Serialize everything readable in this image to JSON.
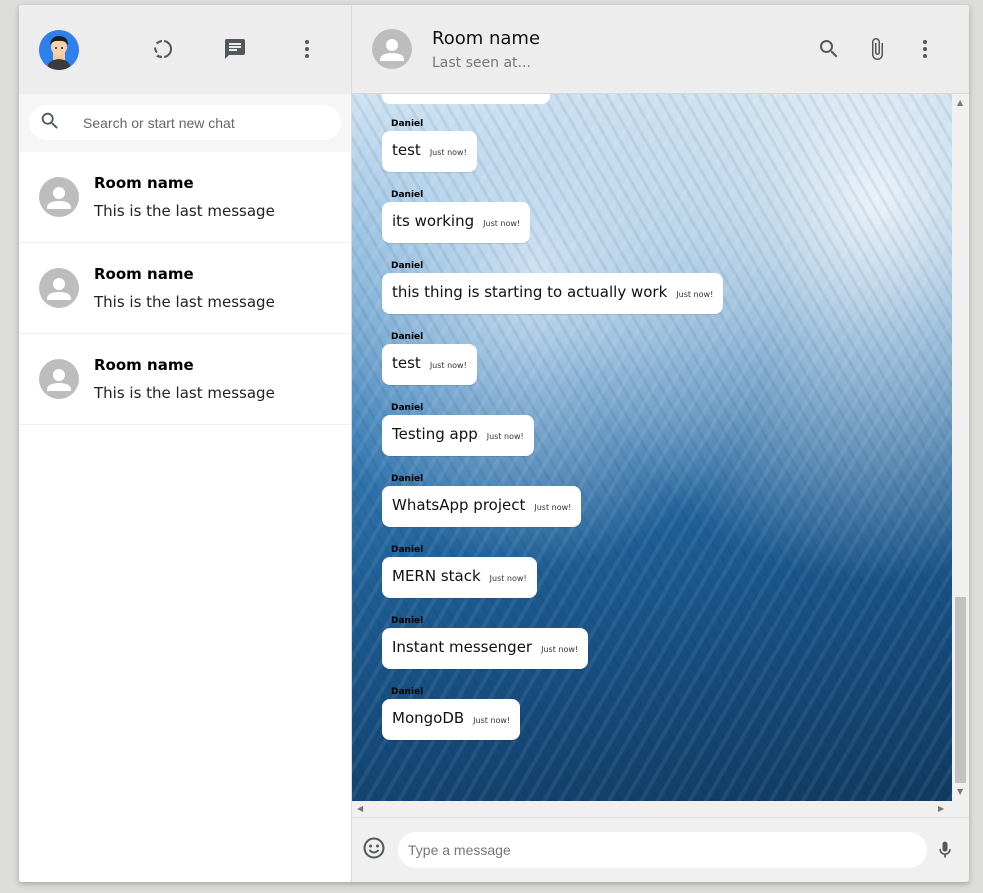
{
  "sidebar": {
    "search_placeholder": "Search or start new chat",
    "chats": [
      {
        "name": "Room name",
        "last": "This is the last message"
      },
      {
        "name": "Room name",
        "last": "This is the last message"
      },
      {
        "name": "Room name",
        "last": "This is the last message"
      }
    ]
  },
  "chat": {
    "title": "Room name",
    "subtitle": "Last seen at...",
    "messages": [
      {
        "sender": "Daniel",
        "text": "test",
        "time": "Just now!"
      },
      {
        "sender": "Daniel",
        "text": "its working",
        "time": "Just now!"
      },
      {
        "sender": "Daniel",
        "text": "this thing is starting to actually work",
        "time": "Just now!"
      },
      {
        "sender": "Daniel",
        "text": "test",
        "time": "Just now!"
      },
      {
        "sender": "Daniel",
        "text": "Testing app",
        "time": "Just now!"
      },
      {
        "sender": "Daniel",
        "text": "WhatsApp project",
        "time": "Just now!"
      },
      {
        "sender": "Daniel",
        "text": "MERN stack",
        "time": "Just now!"
      },
      {
        "sender": "Daniel",
        "text": "Instant messenger",
        "time": "Just now!"
      },
      {
        "sender": "Daniel",
        "text": "MongoDB",
        "time": "Just now!"
      }
    ],
    "input_placeholder": "Type a message"
  },
  "icons": {
    "sidebar_header": [
      "status-icon",
      "new-chat-icon",
      "more-vert-icon"
    ],
    "chat_header": [
      "search-icon",
      "attach-icon",
      "more-vert-icon"
    ],
    "footer": [
      "emoji-icon",
      "mic-icon"
    ]
  },
  "colors": {
    "header_bg": "#ededed",
    "bubble_bg": "#ffffff",
    "avatar_placeholder": "#bdbdbd"
  }
}
